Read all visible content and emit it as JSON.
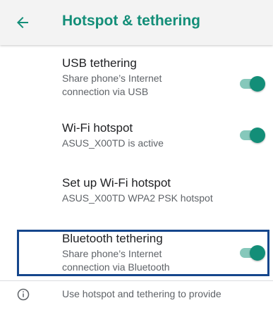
{
  "app_bar": {
    "title": "Hotspot & tethering",
    "back_icon": "arrow-back-icon",
    "title_color": "#138e78"
  },
  "settings": [
    {
      "title": "USB tethering",
      "summary": "Share phone's Internet connection via USB",
      "summary_line1": "Share phone’s Internet",
      "summary_line2": "connection via USB",
      "toggle_on": true
    },
    {
      "title": "Wi-Fi hotspot",
      "summary": "ASUS_X00TD is active",
      "toggle_on": true
    },
    {
      "title": "Set up Wi-Fi hotspot",
      "summary": "ASUS_X00TD WPA2 PSK hotspot"
    },
    {
      "title": "Bluetooth tethering",
      "summary_line1": "Share phone’s Internet",
      "summary_line2": "connection via Bluetooth",
      "toggle_on": true,
      "highlighted": true
    }
  ],
  "footer": {
    "info_icon": "info-icon",
    "text": "Use hotspot and tethering to provide"
  },
  "colors": {
    "accent": "#138e78",
    "toggle_track": "#86c8bb",
    "highlight_border": "#15468c"
  }
}
